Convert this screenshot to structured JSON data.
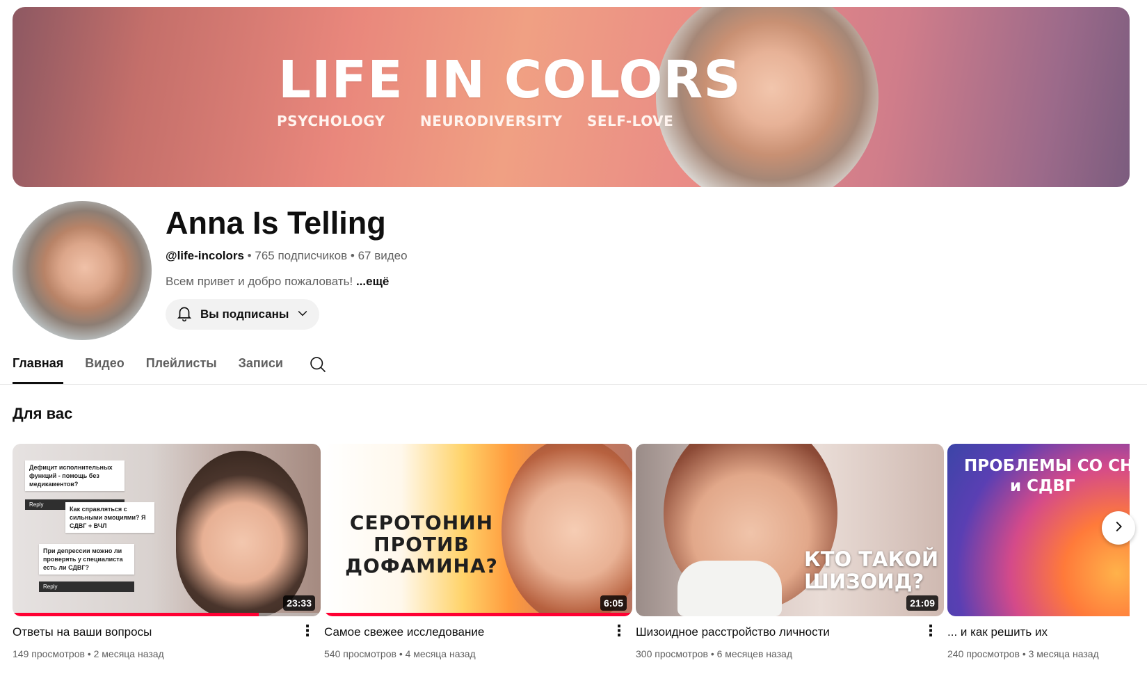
{
  "banner": {
    "title": "LIFE IN COLORS",
    "tags": [
      "PSYCHOLOGY",
      "NEURODIVERSITY",
      "SELF-LOVE"
    ]
  },
  "channel": {
    "name": "Anna Is Telling",
    "handle": "@life-incolors",
    "subscribers": "765 подписчиков",
    "videos_count": "67 видео",
    "separator": "•",
    "description": "Всем привет и добро пожаловать!",
    "more_label": "...ещё",
    "subscribe_label": "Вы подписаны"
  },
  "tabs": [
    {
      "label": "Главная",
      "active": true
    },
    {
      "label": "Видео",
      "active": false
    },
    {
      "label": "Плейлисты",
      "active": false
    },
    {
      "label": "Записи",
      "active": false
    }
  ],
  "section": {
    "title": "Для вас"
  },
  "videos": [
    {
      "title": "Ответы на ваши вопросы",
      "views": "149 просмотров",
      "age": "2 месяца назад",
      "duration": "23:33",
      "watched_fraction": 0.8,
      "thumb_notes": [
        "Дефицит исполнительных функций - помощь без медикаментов?",
        "Как справляться с сильными эмоциями? Я СДВГ + ВЧЛ",
        "При депрессии можно ли проверять у специалиста есть ли СДВГ?"
      ],
      "reply_label": "Reply"
    },
    {
      "title": "Самое свежее исследование",
      "views": "540 просмотров",
      "age": "4 месяца назад",
      "duration": "6:05",
      "watched_fraction": 1.0,
      "thumb_text": [
        "СЕРОТОНИН",
        "ПРОТИВ",
        "ДОФАМИНА?"
      ]
    },
    {
      "title": "Шизоидное расстройство личности",
      "views": "300 просмотров",
      "age": "6 месяцев назад",
      "duration": "21:09",
      "thumb_text": [
        "КТО ТАКОЙ",
        "ШИЗОИД?"
      ]
    },
    {
      "title": "... и как решить их",
      "views": "240 просмотров",
      "age": "3 месяца назад",
      "thumb_text": [
        "ПРОБЛЕМЫ СО СНОМ",
        "и СДВГ"
      ]
    }
  ],
  "meta_separator": "•",
  "icons": {
    "bell": "bell-icon",
    "chevron": "chevron-down-icon",
    "search": "search-icon",
    "next": "chevron-right-icon",
    "more": "more-vert-icon"
  },
  "colors": {
    "progress": "#ff0033",
    "text_secondary": "#606060"
  }
}
